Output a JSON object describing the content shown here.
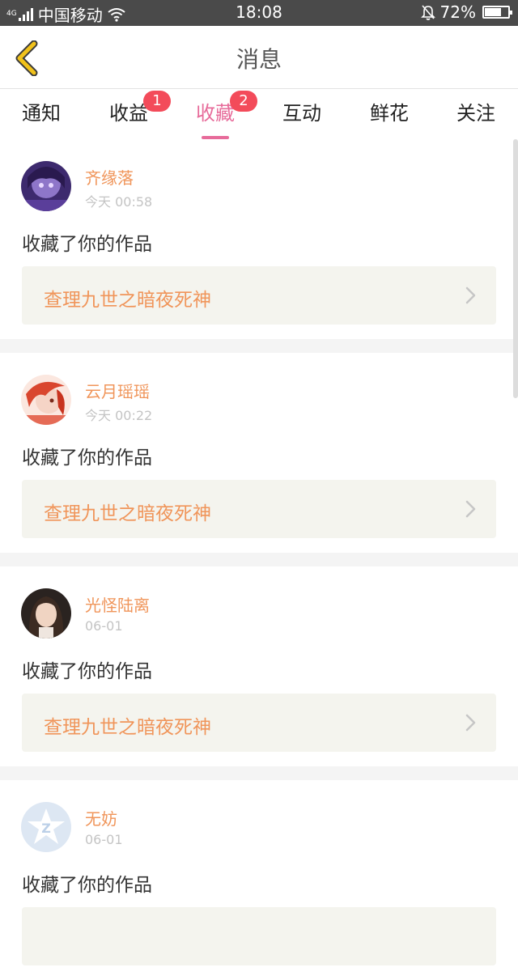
{
  "status_bar": {
    "network": "4G",
    "carrier": "中国移动",
    "time": "18:08",
    "battery": "72%",
    "battery_level": 0.72
  },
  "header": {
    "title": "消息"
  },
  "tabs": [
    {
      "label": "通知",
      "badge": null,
      "active": false
    },
    {
      "label": "收益",
      "badge": "1",
      "active": false
    },
    {
      "label": "收藏",
      "badge": "2",
      "active": true
    },
    {
      "label": "互动",
      "badge": null,
      "active": false
    },
    {
      "label": "鲜花",
      "badge": null,
      "active": false
    },
    {
      "label": "关注",
      "badge": null,
      "active": false
    }
  ],
  "messages": [
    {
      "user": "齐缘落",
      "time": "今天 00:58",
      "text": "收藏了你的作品",
      "work": "查理九世之暗夜死神",
      "avatar": "anime-purple"
    },
    {
      "user": "云月瑶瑶",
      "time": "今天 00:22",
      "text": "收藏了你的作品",
      "work": "查理九世之暗夜死神",
      "avatar": "anime-red"
    },
    {
      "user": "光怪陆离",
      "time": "06-01",
      "text": "收藏了你的作品",
      "work": "查理九世之暗夜死神",
      "avatar": "portrait"
    },
    {
      "user": "无妨",
      "time": "06-01",
      "text": "收藏了你的作品",
      "work": "",
      "avatar": "default-qq"
    }
  ],
  "colors": {
    "accent": "#e76b9a",
    "name": "#f0955a",
    "badge": "#f34b5a",
    "back_icon": "#f1c21b"
  }
}
